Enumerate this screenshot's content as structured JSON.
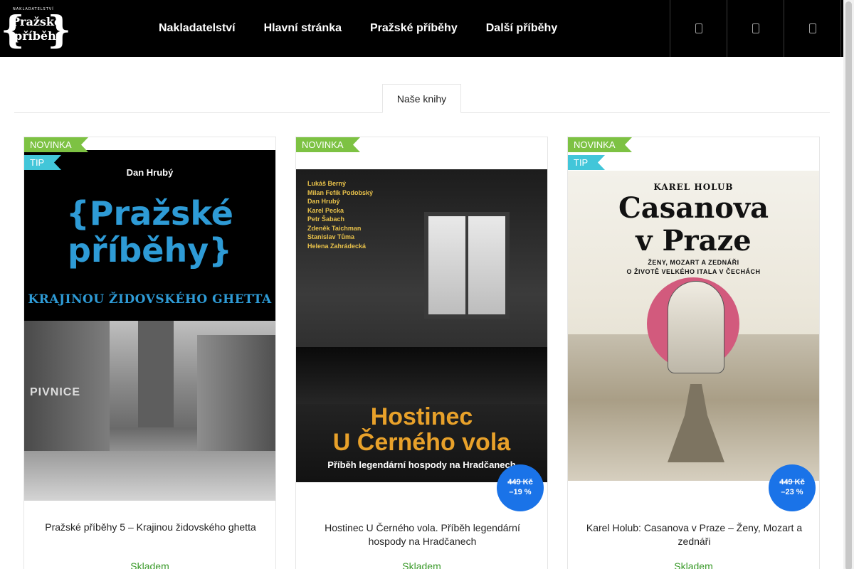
{
  "header": {
    "logo": {
      "publisher": "NAKLADATELSTVÍ",
      "line1": "Pražské",
      "line2": "příběhy",
      "brace_left": "{",
      "brace_right": "}"
    },
    "nav": [
      {
        "label": "Nakladatelství"
      },
      {
        "label": "Hlavní stránka"
      },
      {
        "label": "Pražské příběhy"
      },
      {
        "label": "Další příběhy"
      }
    ],
    "icons": [
      "search-icon",
      "user-icon",
      "cart-icon"
    ]
  },
  "tabs": [
    {
      "label": "Naše knihy",
      "active": true
    }
  ],
  "colors": {
    "header_bg": "#000000",
    "badge_new": "#7dc243",
    "badge_tip": "#42c6d9",
    "price_badge": "#1a73e8",
    "stock": "#3a9a2a"
  },
  "products": [
    {
      "badge_new": "NOVINKA",
      "badge_tip": "TIP",
      "title": "Pražské příběhy 5 – Krajinou židovského ghetta",
      "stock": "Skladem",
      "cover": {
        "author": "Dan Hrubý",
        "title_line1": "{Pražské",
        "title_line2": "příběhy}",
        "subtitle": "KRAJINOU ŽIDOVSKÉHO GHETTA",
        "sign": "PIVNICE"
      }
    },
    {
      "badge_new": "NOVINKA",
      "title": "Hostinec U Černého vola. Příběh legendární hospody na Hradčanech",
      "stock": "Skladem",
      "price_old": "449 Kč",
      "discount": "–19 %",
      "cover": {
        "authors": [
          "Lukáš Berný",
          "Milan Fefík Podobský",
          "Dan Hrubý",
          "Karel Pecka",
          "Petr Šabach",
          "Zdeněk Taichman",
          "Stanislav Tůma",
          "Helena Zahrádecká"
        ],
        "title_line1": "Hostinec",
        "title_line2": "U Černého vola",
        "subtitle": "Příběh legendární hospody na Hradčanech"
      }
    },
    {
      "badge_new": "NOVINKA",
      "badge_tip": "TIP",
      "title": "Karel Holub: Casanova v Praze – Ženy, Mozart a zednáři",
      "stock": "Skladem",
      "price_old": "449 Kč",
      "discount": "–23 %",
      "cover": {
        "author": "KAREL HOLUB",
        "title_line1": "Casanova",
        "title_line2": "v Praze",
        "subtitle1": "ŽENY, MOZART A ZEDNÁŘI",
        "subtitle2": "O ŽIVOTĚ VELKÉHO ITALA V ČECHÁCH"
      }
    }
  ]
}
